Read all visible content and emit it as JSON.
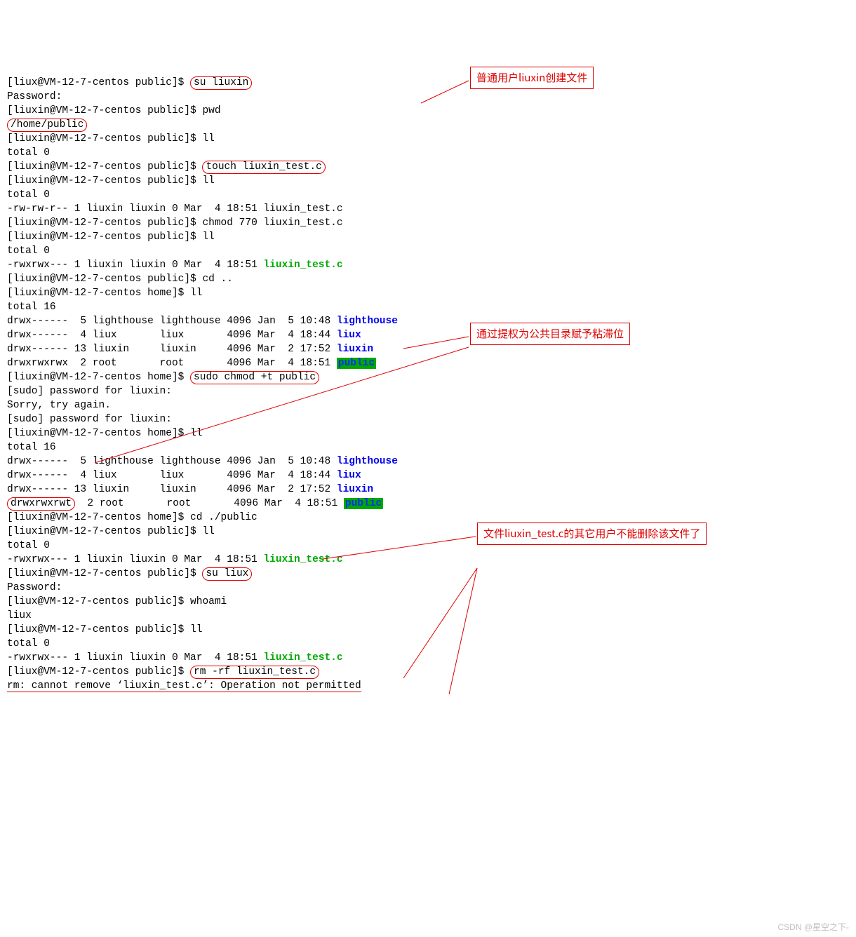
{
  "prompt1": "[liux@VM-12-7-centos public]$ ",
  "prompt2": "[liuxin@VM-12-7-centos public]$ ",
  "prompt3": "[liuxin@VM-12-7-centos home]$ ",
  "cmds": {
    "su_liuxin": "su liuxin",
    "password": "Password:",
    "pwd": "pwd",
    "pwd_out": "/home/public",
    "ll": "ll",
    "total0": "total 0",
    "total16": "total 16",
    "touch": "touch liuxin_test.c",
    "ls_entry1": "-rw-rw-r-- 1 liuxin liuxin 0 Mar  4 18:51 liuxin_test.c",
    "chmod770": "chmod 770 liuxin_test.c",
    "ls_entry2_pre": "-rwxrwx--- 1 liuxin liuxin 0 Mar  4 18:51 ",
    "liuxin_test_c": "liuxin_test.c",
    "cd_up": "cd ..",
    "home_l1_pre": "drwx------  5 lighthouse lighthouse 4096 Jan  5 10:48 ",
    "lighthouse": "lighthouse",
    "home_l2_pre": "drwx------  4 liux       liux       4096 Mar  4 18:44 ",
    "liux": "liux",
    "home_l3_pre": "drwx------ 13 liuxin     liuxin     4096 Mar  2 17:52 ",
    "liuxin": "liuxin",
    "home_l4_pre": "drwxrwxrwx  2 root       root       4096 Mar  4 18:51 ",
    "public": "public",
    "sudo_chmod": "sudo chmod +t public",
    "sudo_pw": "[sudo] password for liuxin:",
    "sorry": "Sorry, try again.",
    "sticky_perms": "drwxrwxrwt",
    "sticky_rest": "  2 root       root       4096 Mar  4 18:51 ",
    "cd_public": "cd ./public",
    "su_liux": "su liux",
    "whoami": "whoami",
    "whoami_out": "liux",
    "rm_cmd": "rm -rf liuxin_test.c",
    "rm_err": "rm: cannot remove ‘liuxin_test.c’: Operation not permitted"
  },
  "annotations": {
    "a1": "普通用户liuxin创建文件",
    "a2": "通过提权为公共目录赋予粘滞位",
    "a3": "文件liuxin_test.c的其它用户不能删除该文件了"
  },
  "watermark": "CSDN @星空之下-"
}
